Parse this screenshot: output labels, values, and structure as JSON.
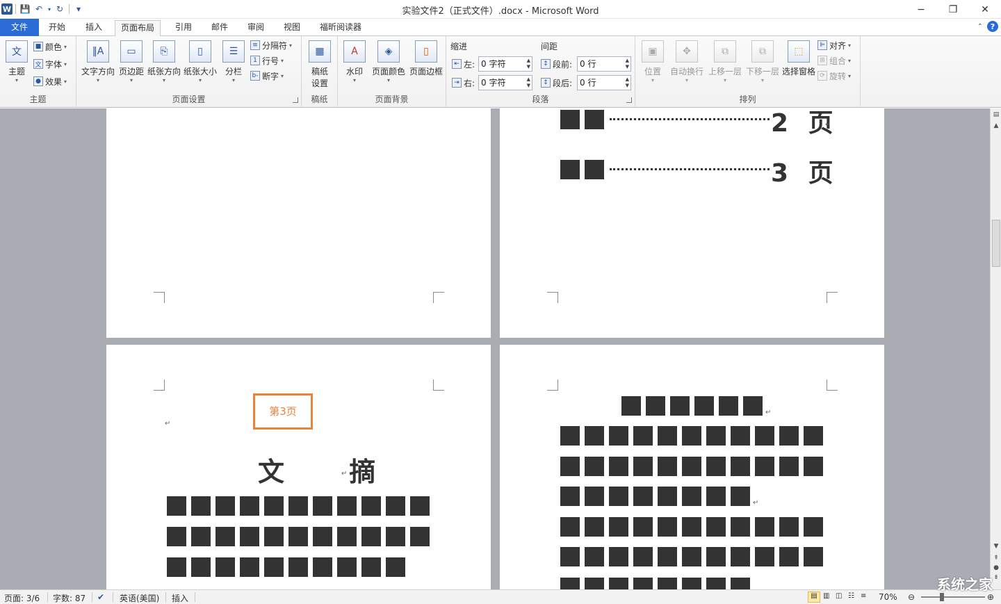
{
  "window": {
    "title": "实验文件2（正式文件）.docx - Microsoft Word",
    "minimize": "−",
    "restore": "❐",
    "close": "✕"
  },
  "quick_access": {
    "app_icon": "W",
    "save_icon": "💾",
    "undo_icon": "↶",
    "redo_icon": "↻",
    "customize_icon": "▾"
  },
  "tabs": [
    {
      "label": "文件"
    },
    {
      "label": "开始"
    },
    {
      "label": "插入"
    },
    {
      "label": "页面布局"
    },
    {
      "label": "引用"
    },
    {
      "label": "邮件"
    },
    {
      "label": "审阅"
    },
    {
      "label": "视图"
    },
    {
      "label": "福昕阅读器"
    }
  ],
  "active_tab": "页面布局",
  "ribbon": {
    "theme_group": {
      "label": "主题",
      "themes": "主题",
      "colors": "颜色",
      "fonts": "字体",
      "effects": "效果"
    },
    "page_setup": {
      "label": "页面设置",
      "text_direction": "文字方向",
      "margins": "页边距",
      "orientation": "纸张方向",
      "size": "纸张大小",
      "columns": "分栏",
      "breaks": "分隔符",
      "line_numbers": "行号",
      "hyphenation": "断字"
    },
    "manuscript": {
      "label": "稿纸",
      "settings_line1": "稿纸",
      "settings_line2": "设置"
    },
    "page_background": {
      "label": "页面背景",
      "watermark": "水印",
      "page_color": "页面颜色",
      "page_borders": "页面边框"
    },
    "paragraph": {
      "label": "段落",
      "indent_header": "缩进",
      "spacing_header": "间距",
      "left_label": "左:",
      "left_value": "0 字符",
      "right_label": "右:",
      "right_value": "0 字符",
      "before_label": "段前:",
      "before_value": "0 行",
      "after_label": "段后:",
      "after_value": "0 行"
    },
    "arrange": {
      "label": "排列",
      "position": "位置",
      "wrap_text": "自动换行",
      "bring_forward": "上移一层",
      "send_backward": "下移一层",
      "selection_pane": "选择窗格",
      "align": "对齐",
      "group": "组合",
      "rotate": "旋转"
    }
  },
  "document": {
    "toc_page_2": "2 页",
    "toc_page_3": "3 页",
    "page_label_box": "第3页",
    "abstract_heading": "文 摘",
    "paragraph_mark": "↵"
  },
  "statusbar": {
    "page": "页面: 3/6",
    "words": "字数: 87",
    "language": "英语(美国)",
    "mode": "插入",
    "zoom": "70%",
    "watermark_text": "系统之家"
  }
}
